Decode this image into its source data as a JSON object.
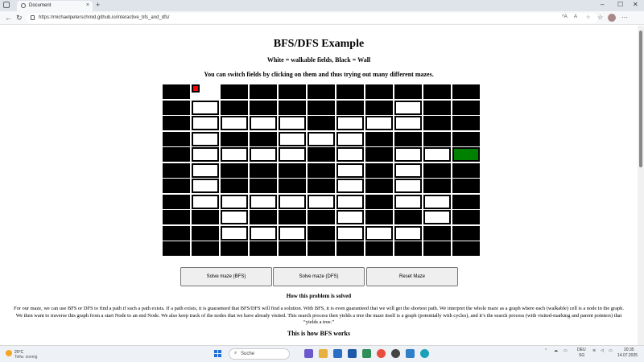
{
  "browser": {
    "tab_title": "Document",
    "tab_close": "×",
    "new_tab": "+",
    "url": "https://michaelpeterschmid.github.io/interactive_bfs_and_dfs/",
    "back": "←",
    "reload": "↻",
    "minimize": "–",
    "maximize": "☐",
    "close": "✕"
  },
  "page": {
    "title": "BFS/DFS Example",
    "legend": "White = walkable fields, Black = Wall",
    "instruction": "You can switch fields by clicking on them and thus trying out many different mazes.",
    "buttons": {
      "solve_bfs": "Solve maze (BFS)",
      "solve_dfs": "Solve maze (DFS)",
      "reset": "Reset Maze"
    },
    "section_title": "How this problem is solved",
    "section_text": "For our maze, we can use BFS or DFS to find a path if such a path exists. If a path exists, it is guaranteed that BFS/DFS will find a solution. With BFS, it is even guaranteed that we will get the shortest path. We interpret the whole maze as a graph where each (walkable) cell is a node in the graph. We then want to traverse this graph from a start Node to an end Node. We also keep track of the nodes that we have already visited. This search process then yields a tree the maze itself is a graph (potentially with cycles), and it’s the search process (with visited-marking and parent pointers) that “yields a tree.”",
    "section_title_2": "This is how BFS works"
  },
  "maze": {
    "legend_values": {
      "0": "wall",
      "1": "walkable",
      "S": "start",
      "E": "end"
    },
    "rows": [
      [
        "0",
        "S",
        "0",
        "0",
        "0",
        "0",
        "0",
        "0",
        "0",
        "0",
        "0"
      ],
      [
        "0",
        "1",
        "0",
        "0",
        "0",
        "0",
        "0",
        "0",
        "1",
        "0",
        "0"
      ],
      [
        "0",
        "1",
        "1",
        "1",
        "1",
        "0",
        "1",
        "1",
        "1",
        "0",
        "0"
      ],
      [
        "0",
        "1",
        "0",
        "0",
        "1",
        "1",
        "1",
        "0",
        "0",
        "0",
        "0"
      ],
      [
        "0",
        "1",
        "1",
        "1",
        "1",
        "0",
        "1",
        "0",
        "1",
        "1",
        "E"
      ],
      [
        "0",
        "1",
        "0",
        "0",
        "0",
        "0",
        "1",
        "0",
        "1",
        "0",
        "0"
      ],
      [
        "0",
        "1",
        "0",
        "0",
        "0",
        "0",
        "1",
        "0",
        "1",
        "0",
        "0"
      ],
      [
        "0",
        "1",
        "1",
        "1",
        "1",
        "1",
        "1",
        "0",
        "1",
        "1",
        "0"
      ],
      [
        "0",
        "0",
        "1",
        "0",
        "0",
        "0",
        "1",
        "0",
        "0",
        "1",
        "0"
      ],
      [
        "0",
        "0",
        "1",
        "1",
        "1",
        "0",
        "1",
        "1",
        "1",
        "0",
        "0"
      ],
      [
        "0",
        "0",
        "0",
        "0",
        "0",
        "0",
        "0",
        "0",
        "0",
        "0",
        "0"
      ]
    ],
    "colors": {
      "wall": "#000000",
      "walkable": "#ffffff",
      "start": "#ff0000",
      "end": "#008000"
    }
  },
  "taskbar": {
    "temperature": "25°C",
    "weather": "Teilw. sonnig",
    "search_placeholder": "Suche",
    "language": "DEU",
    "region": "SG",
    "time": "20:35",
    "date": "14.07.2025"
  }
}
